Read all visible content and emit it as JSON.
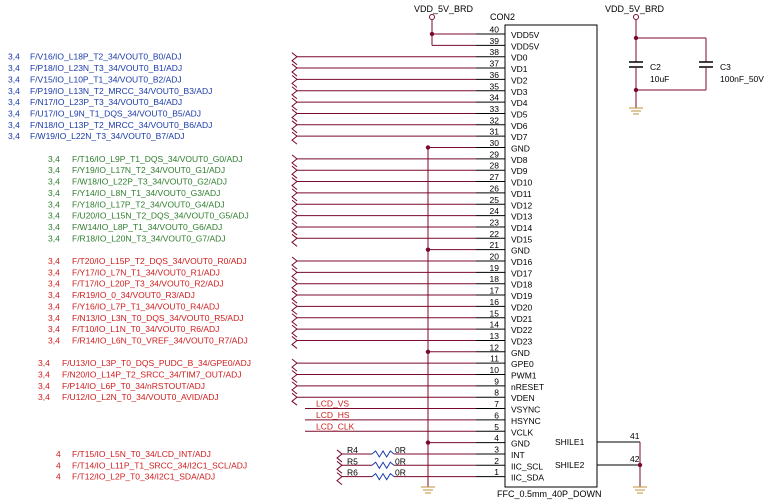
{
  "power": {
    "label": "VDD_5V_BRD"
  },
  "connector": {
    "designator": "CON2",
    "part": "FFC_0.5mm_40P_DOWN",
    "shield_pins": [
      {
        "name": "SHILE1",
        "number": "41"
      },
      {
        "name": "SHILE2",
        "number": "42"
      }
    ]
  },
  "capacitors": [
    {
      "ref": "C2",
      "value": "10uF"
    },
    {
      "ref": "C3",
      "value": "100nF_50V"
    }
  ],
  "resistors": [
    {
      "ref": "R4",
      "value": "0R"
    },
    {
      "ref": "R5",
      "value": "0R"
    },
    {
      "ref": "R6",
      "value": "0R"
    }
  ],
  "colors": {
    "blue": "#1a3aa8",
    "green": "#2e7d2e",
    "red": "#d01c1c",
    "wire": "#7a0a2a",
    "ink": "#000000",
    "ground": "#c0903a"
  },
  "pins": [
    {
      "n": "40",
      "name": "VDD5V"
    },
    {
      "n": "39",
      "name": "VDD5V"
    },
    {
      "n": "38",
      "name": "VD0"
    },
    {
      "n": "37",
      "name": "VD1"
    },
    {
      "n": "36",
      "name": "VD2"
    },
    {
      "n": "35",
      "name": "VD3"
    },
    {
      "n": "34",
      "name": "VD4"
    },
    {
      "n": "33",
      "name": "VD5"
    },
    {
      "n": "32",
      "name": "VD6"
    },
    {
      "n": "31",
      "name": "VD7"
    },
    {
      "n": "30",
      "name": "GND"
    },
    {
      "n": "29",
      "name": "VD8"
    },
    {
      "n": "28",
      "name": "VD9"
    },
    {
      "n": "27",
      "name": "VD10"
    },
    {
      "n": "26",
      "name": "VD11"
    },
    {
      "n": "25",
      "name": "VD12"
    },
    {
      "n": "24",
      "name": "VD13"
    },
    {
      "n": "23",
      "name": "VD14"
    },
    {
      "n": "22",
      "name": "VD15"
    },
    {
      "n": "21",
      "name": "GND"
    },
    {
      "n": "20",
      "name": "VD16"
    },
    {
      "n": "19",
      "name": "VD17"
    },
    {
      "n": "18",
      "name": "VD18"
    },
    {
      "n": "17",
      "name": "VD19"
    },
    {
      "n": "16",
      "name": "VD20"
    },
    {
      "n": "15",
      "name": "VD21"
    },
    {
      "n": "14",
      "name": "VD22"
    },
    {
      "n": "13",
      "name": "VD23"
    },
    {
      "n": "12",
      "name": "GND"
    },
    {
      "n": "11",
      "name": "GPE0"
    },
    {
      "n": "10",
      "name": "PWM1"
    },
    {
      "n": "9",
      "name": "nRESET"
    },
    {
      "n": "8",
      "name": "VDEN"
    },
    {
      "n": "7",
      "name": "VSYNC"
    },
    {
      "n": "6",
      "name": "HSYNC"
    },
    {
      "n": "5",
      "name": "VCLK"
    },
    {
      "n": "4",
      "name": "GND"
    },
    {
      "n": "3",
      "name": "INT"
    },
    {
      "n": "2",
      "name": "IIC_SCL"
    },
    {
      "n": "1",
      "name": "IIC_SDA"
    }
  ],
  "nets": [
    {
      "pin": "38",
      "prefix": "3,4",
      "label": "F/V16/IO_L18P_T2_34/VOUT0_B0/ADJ",
      "group": "blue"
    },
    {
      "pin": "37",
      "prefix": "3,4",
      "label": "F/P18/IO_L23N_T3_34/VOUT0_B1/ADJ",
      "group": "blue"
    },
    {
      "pin": "36",
      "prefix": "3,4",
      "label": "F/V15/IO_L10P_T1_34/VOUT0_B2/ADJ",
      "group": "blue"
    },
    {
      "pin": "35",
      "prefix": "3,4",
      "label": "F/P19/IO_L13N_T2_MRCC_34/VOUT0_B3/ADJ",
      "group": "blue"
    },
    {
      "pin": "34",
      "prefix": "3,4",
      "label": "F/N17/IO_L23P_T3_34/VOUT0_B4/ADJ",
      "group": "blue"
    },
    {
      "pin": "33",
      "prefix": "3,4",
      "label": "F/U17/IO_L9N_T1_DQS_34/VOUT0_B5/ADJ",
      "group": "blue"
    },
    {
      "pin": "32",
      "prefix": "3,4",
      "label": "F/N18/IO_L13P_T2_MRCC_34/VOUT0_B6/ADJ",
      "group": "blue"
    },
    {
      "pin": "31",
      "prefix": "3,4",
      "label": "F/W19/IO_L22N_T3_34/VOUT0_B7/ADJ",
      "group": "blue"
    },
    {
      "pin": "29",
      "prefix": "3,4",
      "label": "F/T16/IO_L9P_T1_DQS_34/VOUT0_G0/ADJ",
      "group": "green"
    },
    {
      "pin": "28",
      "prefix": "3,4",
      "label": "F/Y19/IO_L17N_T2_34/VOUT0_G1/ADJ",
      "group": "green"
    },
    {
      "pin": "27",
      "prefix": "3,4",
      "label": "F/W18/IO_L22P_T3_34/VOUT0_G2/ADJ",
      "group": "green"
    },
    {
      "pin": "26",
      "prefix": "3,4",
      "label": "F/Y14/IO_L8N_T1_34/VOUT0_G3/ADJ",
      "group": "green"
    },
    {
      "pin": "25",
      "prefix": "3,4",
      "label": "F/Y18/IO_L17P_T2_34/VOUT0_G4/ADJ",
      "group": "green"
    },
    {
      "pin": "24",
      "prefix": "3,4",
      "label": "F/U20/IO_L15N_T2_DQS_34/VOUT0_G5/ADJ",
      "group": "green"
    },
    {
      "pin": "23",
      "prefix": "3,4",
      "label": "F/W14/IO_L8P_T1_34/VOUT0_G6/ADJ",
      "group": "green"
    },
    {
      "pin": "22",
      "prefix": "3,4",
      "label": "F/R18/IO_L20N_T3_34/VOUT0_G7/ADJ",
      "group": "green"
    },
    {
      "pin": "20",
      "prefix": "3,4",
      "label": "F/T20/IO_L15P_T2_DQS_34/VOUT0_R0/ADJ",
      "group": "red"
    },
    {
      "pin": "19",
      "prefix": "3,4",
      "label": "F/Y17/IO_L7N_T1_34/VOUT0_R1/ADJ",
      "group": "red"
    },
    {
      "pin": "18",
      "prefix": "3,4",
      "label": "F/T17/IO_L20P_T3_34/VOUT0_R2/ADJ",
      "group": "red"
    },
    {
      "pin": "17",
      "prefix": "3,4",
      "label": "F/R19/IO_0_34/VOUT0_R3/ADJ",
      "group": "red"
    },
    {
      "pin": "16",
      "prefix": "3,4",
      "label": "F/Y16/IO_L7P_T1_34/VOUT0_R4/ADJ",
      "group": "red"
    },
    {
      "pin": "15",
      "prefix": "3,4",
      "label": "F/N13/IO_L3N_T0_DQS_34/VOUT0_R5/ADJ",
      "group": "red"
    },
    {
      "pin": "14",
      "prefix": "3,4",
      "label": "F/T10/IO_L1N_T0_34/VOUT0_R6/ADJ",
      "group": "red"
    },
    {
      "pin": "13",
      "prefix": "3,4",
      "label": "F/R14/IO_L6N_T0_VREF_34/VOUT0_R7/ADJ",
      "group": "red"
    },
    {
      "pin": "11",
      "prefix": "3,4",
      "label": "F/U13/IO_L3P_T0_DQS_PUDC_B_34/GPE0/ADJ",
      "group": "red"
    },
    {
      "pin": "10",
      "prefix": "3,4",
      "label": "F/N20/IO_L14P_T2_SRCC_34/TIM7_OUT/ADJ",
      "group": "red"
    },
    {
      "pin": "9",
      "prefix": "3,4",
      "label": "F/P14/IO_L6P_T0_34/nRSTOUT/ADJ",
      "group": "red"
    },
    {
      "pin": "8",
      "prefix": "3,4",
      "label": "F/U12/IO_L2N_T0_34/VOUT0_AVID/ADJ",
      "group": "red"
    }
  ],
  "lcd_nets": [
    {
      "pin": "7",
      "label": "LCD_VS"
    },
    {
      "pin": "6",
      "label": "LCD_HS"
    },
    {
      "pin": "5",
      "label": "LCD_CLK"
    }
  ],
  "i2c_nets": [
    {
      "pin": "3",
      "prefix": "4",
      "label": "F/T15/IO_L5N_T0_34/LCD_INT/ADJ",
      "res": "R4"
    },
    {
      "pin": "2",
      "prefix": "4",
      "label": "F/T14/IO_L11P_T1_SRCC_34/I2C1_SCL/ADJ",
      "res": "R5"
    },
    {
      "pin": "1",
      "prefix": "4",
      "label": "F/T12/IO_L2P_T0_34/I2C1_SDA/ADJ",
      "res": "R6"
    }
  ]
}
